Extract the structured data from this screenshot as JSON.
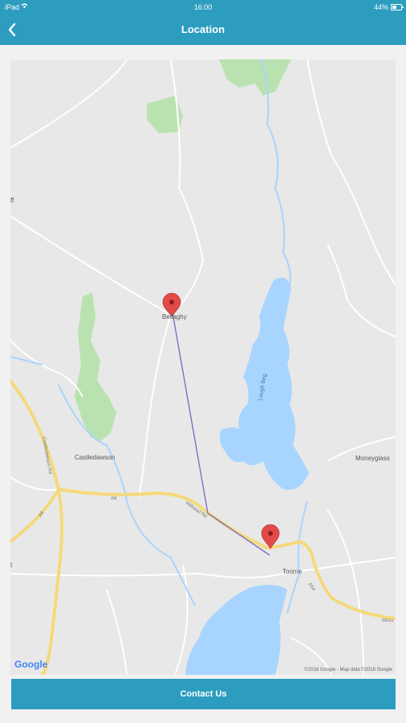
{
  "status_bar": {
    "carrier": "iPad",
    "time": "16:00",
    "battery_percent": "44%",
    "battery_level": 0.44
  },
  "nav": {
    "title": "Location",
    "back_icon": "chevron-left-icon"
  },
  "map": {
    "place_labels": [
      "Bellaghy",
      "Castledawson",
      "Moneyglass",
      "Toome",
      "Lough Beg"
    ],
    "road_labels": [
      "A6",
      "A54",
      "Castledawson Rd",
      "Hillhead Rd",
      "A6",
      "Moss"
    ],
    "edge_labels": [
      "ff",
      "t"
    ],
    "google_logo": "Google",
    "copyright": "©2018 Google - Map data ©2018 Google",
    "colors": {
      "water": "#a8d5ff",
      "road": "#f5d97a",
      "park": "#b9e2b0",
      "route": "#7b6fc4",
      "marker": "#e24a4a"
    }
  },
  "footer": {
    "contact_label": "Contact Us"
  },
  "theme": {
    "primary": "#2c9dbf"
  }
}
